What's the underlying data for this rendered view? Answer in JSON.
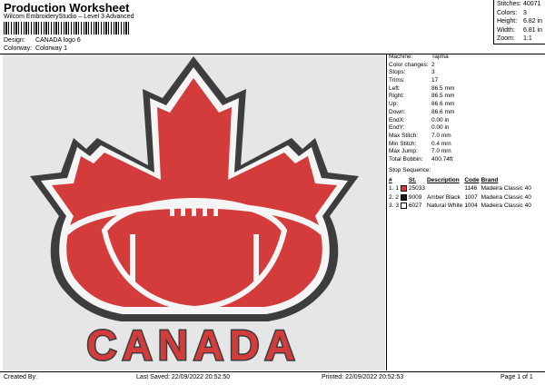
{
  "header": {
    "title": "Production Worksheet",
    "subtitle": "Wilcom EmbroideryStudio – Level 3 Advanced",
    "design_label": "Design:",
    "design_value": "CANADA logo 6",
    "colorway_label": "Colorway:",
    "colorway_value": "Colorway 1"
  },
  "stats": [
    {
      "label": "Stitches:",
      "value": "40071"
    },
    {
      "label": "Colors:",
      "value": "3"
    },
    {
      "label": "Height:",
      "value": "6.82 in"
    },
    {
      "label": "Width:",
      "value": "6.81 in"
    },
    {
      "label": "Zoom:",
      "value": "1:1"
    }
  ],
  "machine_info": [
    {
      "label": "Machine:",
      "value": "Tajima"
    },
    {
      "label": "Color changes:",
      "value": "2"
    },
    {
      "label": "Stops:",
      "value": "3"
    },
    {
      "label": "Trims:",
      "value": "17"
    },
    {
      "label": "Left:",
      "value": "86.5 mm"
    },
    {
      "label": "Right:",
      "value": "86.5 mm"
    },
    {
      "label": "Up:",
      "value": "86.6 mm"
    },
    {
      "label": "Down:",
      "value": "86.6 mm"
    },
    {
      "label": "EndX:",
      "value": "0.00 in"
    },
    {
      "label": "EndY:",
      "value": "0.00 in"
    },
    {
      "label": "Max Stitch:",
      "value": "7.0 mm"
    },
    {
      "label": "Min Stitch:",
      "value": "0.4 mm"
    },
    {
      "label": "Max Jump:",
      "value": "7.0 mm"
    },
    {
      "label": "Total Bobbin:",
      "value": "400.74ft"
    }
  ],
  "stop_sequence": {
    "title": "Stop Sequence:",
    "headers": [
      "#",
      "St.",
      "Description",
      "Code",
      "Brand"
    ],
    "rows": [
      {
        "num": "1.",
        "stop": "1",
        "color": "#d43c3c",
        "stitches": "25033",
        "description": "",
        "code": "1146",
        "brand": "Madeira Classic 40"
      },
      {
        "num": "2.",
        "stop": "2",
        "color": "#1a1a1a",
        "stitches": "9009",
        "description": "Amber Black",
        "code": "1007",
        "brand": "Madeira Classic 40"
      },
      {
        "num": "3.",
        "stop": "3",
        "color": "#ffffff",
        "stitches": "6027",
        "description": "Natural White",
        "code": "1004",
        "brand": "Madeira Classic 40"
      }
    ]
  },
  "design_text": "CANADA",
  "footer": {
    "created_by": "Created By:",
    "last_saved": "Last Saved: 22/09/2022 20:52:50",
    "printed": "Printed: 22/09/2022 20:52:53",
    "page": "Page 1 of 1"
  },
  "colors": {
    "red": "#d43c3c",
    "dark": "#3d3d3d",
    "white": "#f5f5f5",
    "background": "#e6e6e6"
  }
}
